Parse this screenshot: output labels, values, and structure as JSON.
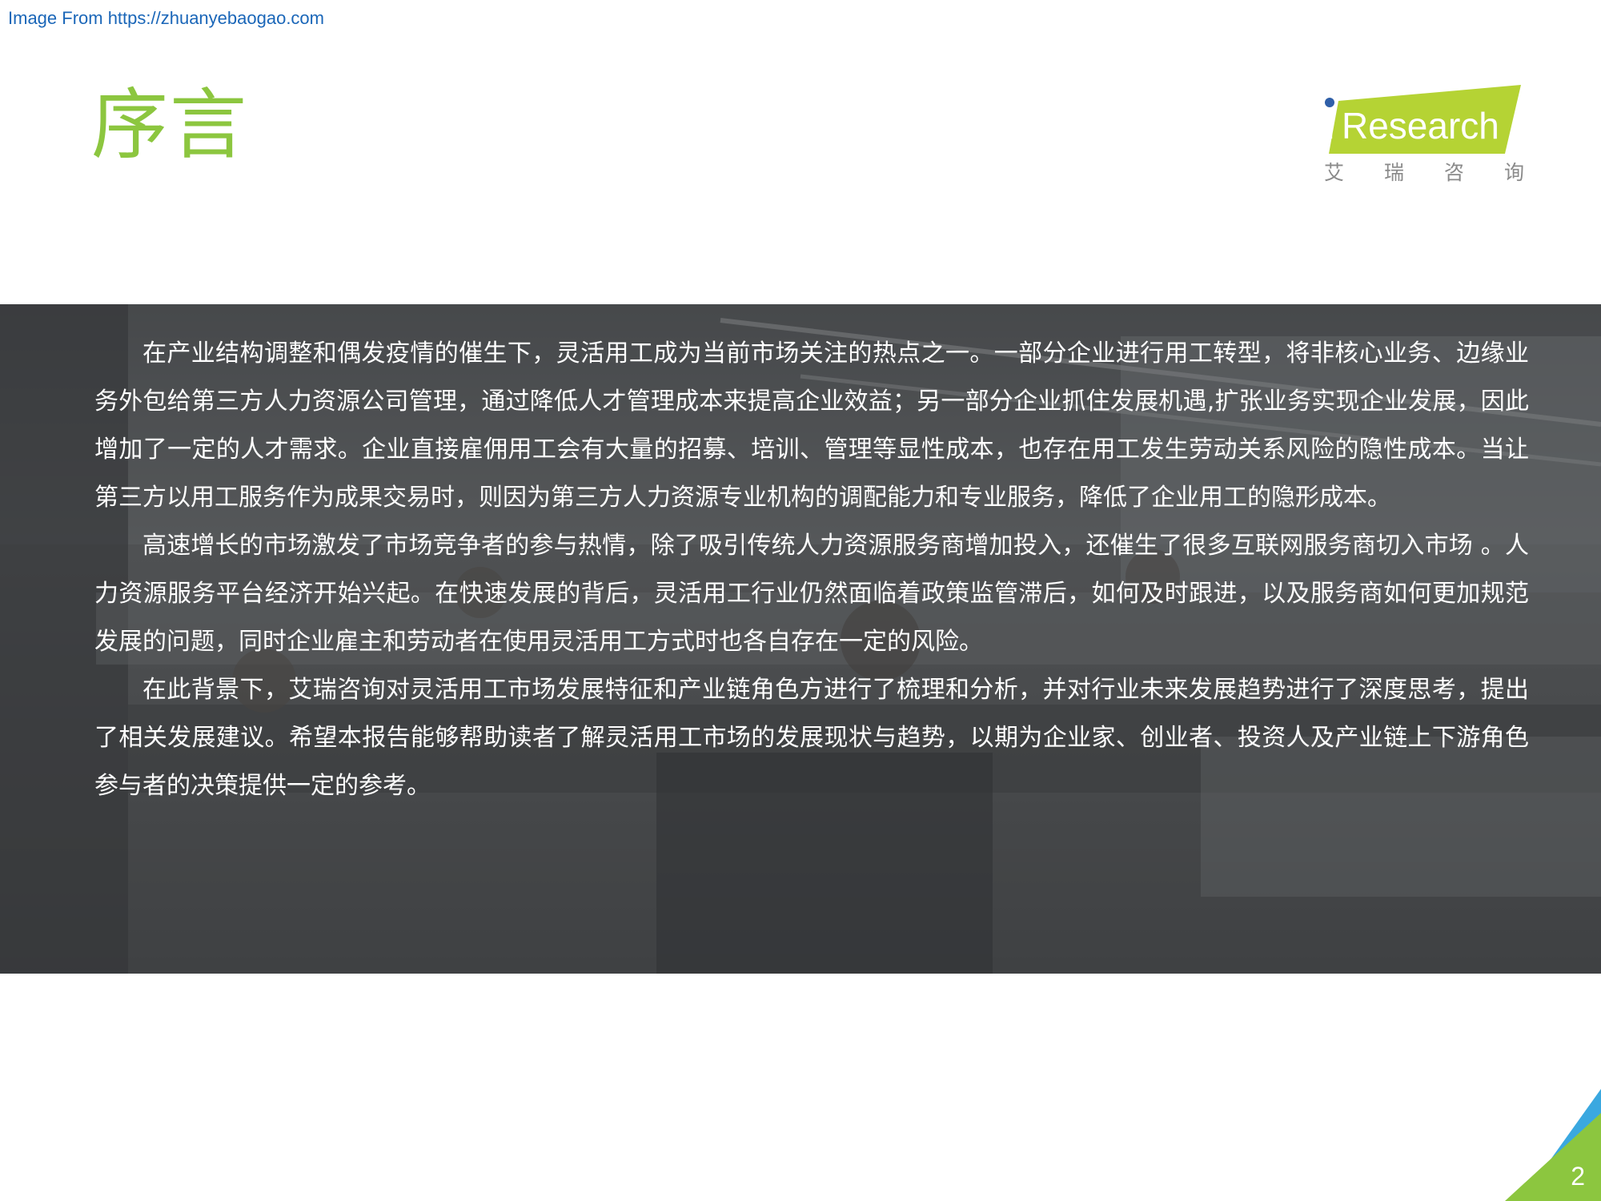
{
  "source_link": "Image From https://zhuanyebaogao.com",
  "title": "序言",
  "logo": {
    "brand": "Research",
    "i_letter": "i",
    "subtitle_chars": [
      "艾",
      "瑞",
      "咨",
      "询"
    ]
  },
  "paragraphs": [
    "在产业结构调整和偶发疫情的催生下，灵活用工成为当前市场关注的热点之一。一部分企业进行用工转型，将非核心业务、边缘业务外包给第三方人力资源公司管理，通过降低人才管理成本来提高企业效益；另一部分企业抓住发展机遇,扩张业务实现企业发展，因此增加了一定的人才需求。企业直接雇佣用工会有大量的招募、培训、管理等显性成本，也存在用工发生劳动关系风险的隐性成本。当让第三方以用工服务作为成果交易时，则因为第三方人力资源专业机构的调配能力和专业服务，降低了企业用工的隐形成本。",
    "高速增长的市场激发了市场竞争者的参与热情，除了吸引传统人力资源服务商增加投入，还催生了很多互联网服务商切入市场 。人力资源服务平台经济开始兴起。在快速发展的背后，灵活用工行业仍然面临着政策监管滞后，如何及时跟进，以及服务商如何更加规范发展的问题，同时企业雇主和劳动者在使用灵活用工方式时也各自存在一定的风险。",
    "在此背景下，艾瑞咨询对灵活用工市场发展特征和产业链角色方进行了梳理和分析，并对行业未来发展趋势进行了深度思考，提出了相关发展建议。希望本报告能够帮助读者了解灵活用工市场的发展现状与趋势，以期为企业家、创业者、投资人及产业链上下游角色参与者的决策提供一定的参考。"
  ],
  "page_number": "2",
  "colors": {
    "title_green": "#8cc63f",
    "logo_green": "#b5d334",
    "logo_blue": "#2f5fa8",
    "corner_blue": "#3aa8e0",
    "corner_green": "#8cc63f"
  }
}
